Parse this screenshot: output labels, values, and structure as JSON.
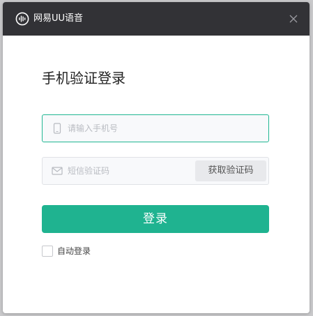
{
  "app": {
    "title": "网易UU语音",
    "logo_icon": "uu-voice-logo",
    "close_icon": "close-icon"
  },
  "login": {
    "heading": "手机验证登录",
    "phone_placeholder": "请输入手机号",
    "phone_value": "",
    "code_placeholder": "短信验证码",
    "code_value": "",
    "get_code_label": "获取验证码",
    "submit_label": "登录",
    "auto_login_label": "自动登录",
    "auto_login_checked": false
  },
  "colors": {
    "titlebar": "#323236",
    "accent": "#1fb390",
    "focus_border": "#20b692"
  }
}
